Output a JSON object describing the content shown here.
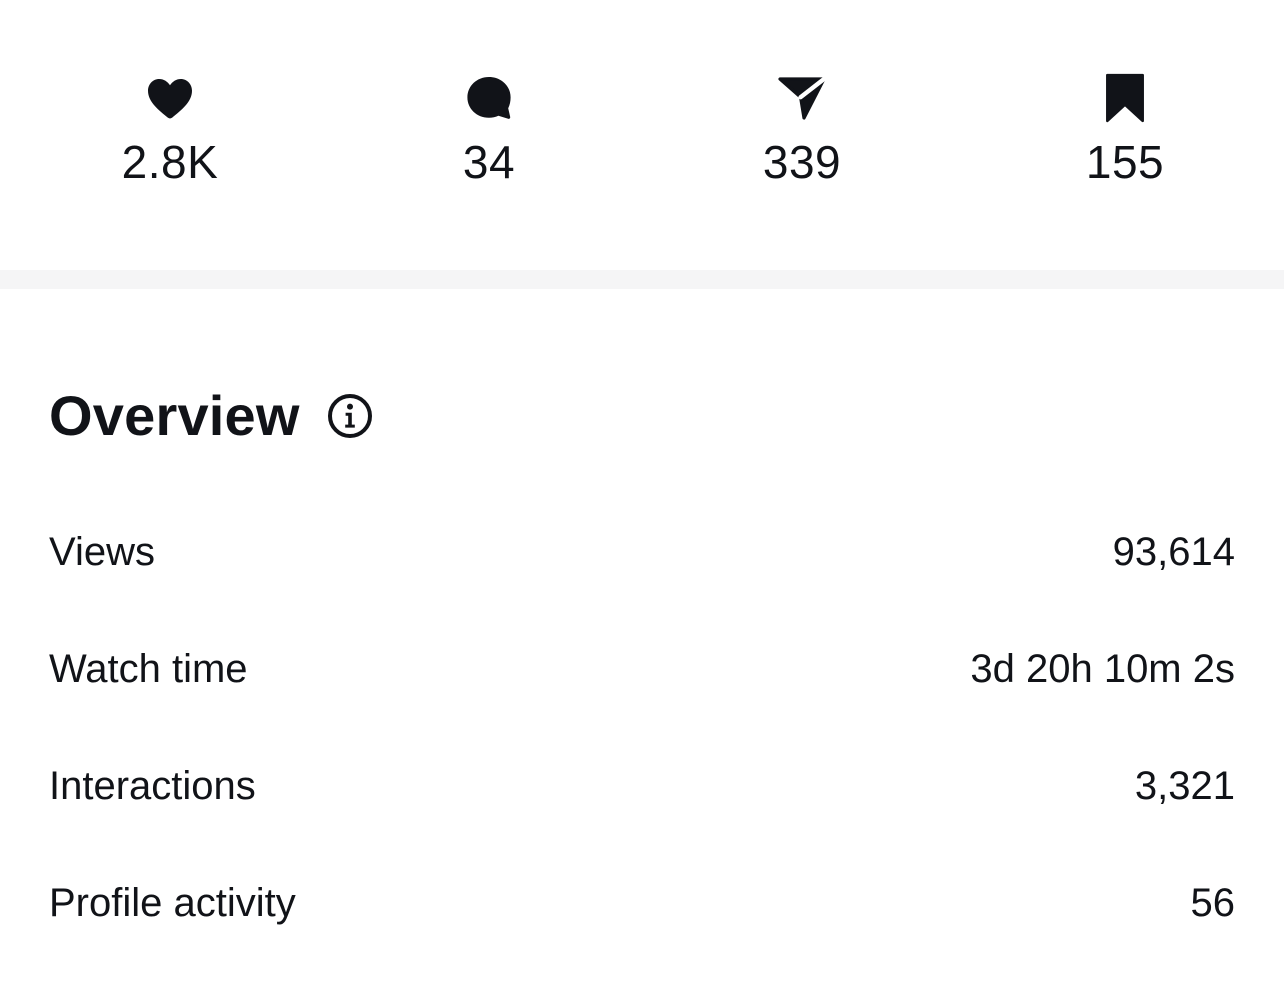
{
  "engagement": {
    "likes": {
      "icon": "heart-icon",
      "count": "2.8K"
    },
    "comments": {
      "icon": "comment-bubble-icon",
      "count": "34"
    },
    "shares": {
      "icon": "send-arrow-icon",
      "count": "339"
    },
    "saves": {
      "icon": "bookmark-icon",
      "count": "155"
    }
  },
  "overview": {
    "title": "Overview",
    "info_icon": "info-icon",
    "metrics": [
      {
        "label": "Views",
        "value": "93,614"
      },
      {
        "label": "Watch time",
        "value": "3d 20h 10m 2s"
      },
      {
        "label": "Interactions",
        "value": "3,321"
      },
      {
        "label": "Profile activity",
        "value": "56"
      }
    ]
  },
  "colors": {
    "text": "#111318",
    "background": "#ffffff",
    "divider": "#f5f5f6"
  }
}
